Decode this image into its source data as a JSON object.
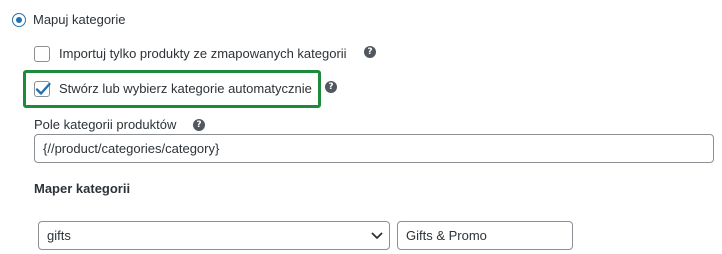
{
  "mapping": {
    "radio_label": "Mapuj kategorie",
    "import_only_mapped_label": "Importuj tylko produkty ze zmapowanych kategorii",
    "auto_create_label": "Stwórz lub wybierz kategorie automatycznie",
    "category_field_label": "Pole kategorii produktów",
    "category_field_value": "{//product/categories/category}",
    "mapper_title": "Maper kategorii",
    "mapper_rows": [
      {
        "select_value": "gifts",
        "text_value": "Gifts & Promo"
      }
    ]
  },
  "states": {
    "radio_selected": true,
    "import_only_mapped_checked": false,
    "auto_create_checked": true
  },
  "help_glyph": "?",
  "colors": {
    "accent": "#2271b1",
    "highlight_border": "#1e8a3b",
    "text": "#2c3338",
    "input_border": "#8c8f94"
  }
}
